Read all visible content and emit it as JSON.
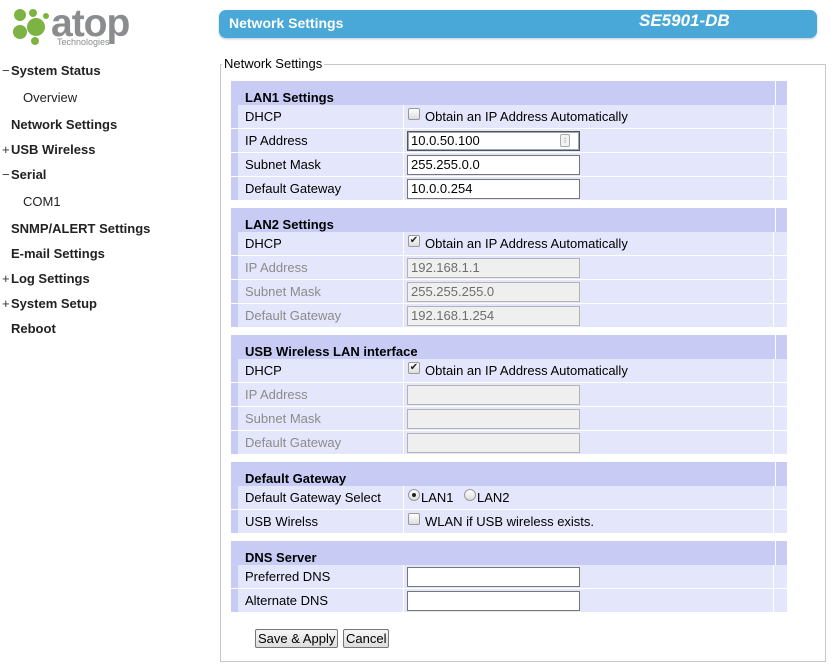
{
  "logo": {
    "word": "atop",
    "sub": "Technologies"
  },
  "header": {
    "title": "Network Settings",
    "model": "SE5901-DB"
  },
  "sidebar": {
    "items": [
      {
        "sign": "−",
        "label": "System Status"
      },
      {
        "sign": "",
        "label": "Overview"
      },
      {
        "sign": "",
        "label": "Network Settings"
      },
      {
        "sign": "+",
        "label": "USB Wireless"
      },
      {
        "sign": "−",
        "label": "Serial"
      },
      {
        "sign": "",
        "label": "COM1"
      },
      {
        "sign": "",
        "label": "SNMP/ALERT Settings"
      },
      {
        "sign": "",
        "label": "E-mail Settings"
      },
      {
        "sign": "+",
        "label": "Log Settings"
      },
      {
        "sign": "+",
        "label": "System Setup"
      },
      {
        "sign": "",
        "label": "Reboot"
      }
    ]
  },
  "legend": "Network Settings",
  "lan1": {
    "title": "LAN1 Settings",
    "dhcp_label": "DHCP",
    "dhcp_text": "Obtain an IP Address Automatically",
    "dhcp_checked": false,
    "ip_label": "IP Address",
    "ip_value": "10.0.50.100",
    "mask_label": "Subnet Mask",
    "mask_value": "255.255.0.0",
    "gw_label": "Default Gateway",
    "gw_value": "10.0.0.254"
  },
  "lan2": {
    "title": "LAN2 Settings",
    "dhcp_label": "DHCP",
    "dhcp_text": "Obtain an IP Address Automatically",
    "dhcp_checked": true,
    "ip_label": "IP Address",
    "ip_value": "192.168.1.1",
    "mask_label": "Subnet Mask",
    "mask_value": "255.255.255.0",
    "gw_label": "Default Gateway",
    "gw_value": "192.168.1.254"
  },
  "usb": {
    "title": "USB Wireless LAN interface",
    "dhcp_label": "DHCP",
    "dhcp_text": "Obtain an IP Address Automatically",
    "dhcp_checked": true,
    "ip_label": "IP Address",
    "ip_value": "",
    "mask_label": "Subnet Mask",
    "mask_value": "",
    "gw_label": "Default Gateway",
    "gw_value": ""
  },
  "gateway": {
    "title": "Default Gateway",
    "select_label": "Default Gateway Select",
    "opt1": "LAN1",
    "opt2": "LAN2",
    "selected": "LAN1",
    "usb_label": "USB Wirelss",
    "usb_text": "WLAN if USB wireless exists.",
    "usb_checked": false
  },
  "dns": {
    "title": "DNS Server",
    "pref_label": "Preferred DNS",
    "pref_value": "",
    "alt_label": "Alternate DNS",
    "alt_value": ""
  },
  "buttons": {
    "save": "Save & Apply",
    "cancel": "Cancel"
  },
  "colors": {
    "header": "#49a8d8",
    "section": "#c8ccf5",
    "row": "#e4e7fb",
    "logo_green": "#7cb342"
  }
}
